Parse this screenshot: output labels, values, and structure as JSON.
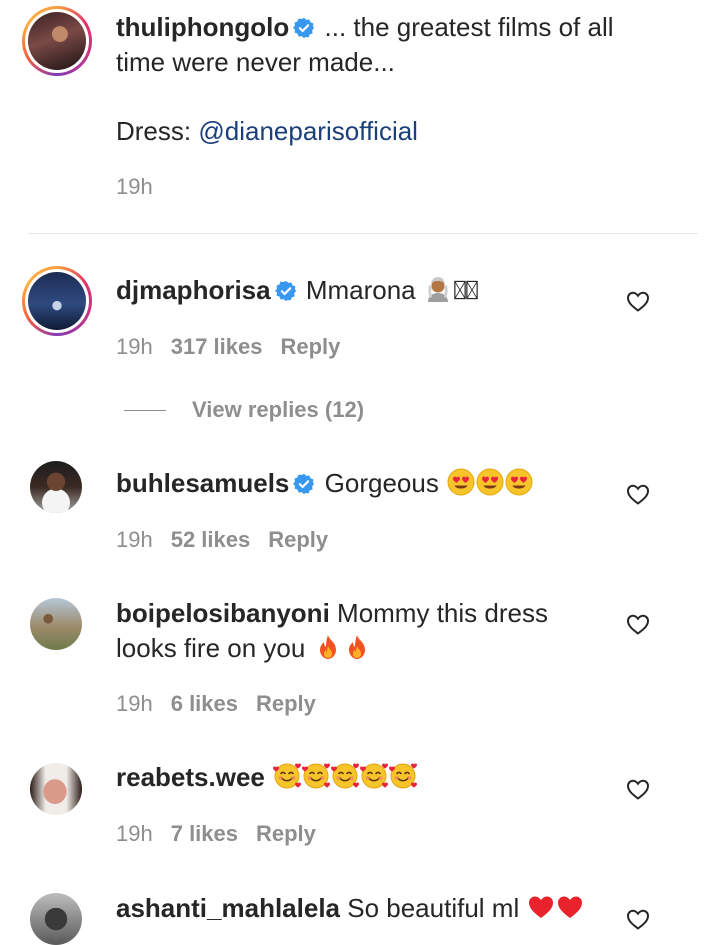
{
  "caption": {
    "username": "thuliphongolo",
    "text_line1": "... the greatest films of all",
    "text_line2": "time were never made...",
    "dress_label": "Dress:",
    "mention": "@dianeparisofficial",
    "time": "19h"
  },
  "comments": [
    {
      "username": "djmaphorisa",
      "text": "Mmarona",
      "emoji_icons": [
        "person-emoji",
        "missing-glyph",
        "missing-glyph"
      ],
      "time": "19h",
      "likes": "317 likes",
      "reply": "Reply",
      "view_replies": "View replies (12)"
    },
    {
      "username": "buhlesamuels",
      "text": "Gorgeous",
      "emoji_icons": [
        "heart-eyes-emoji",
        "heart-eyes-emoji",
        "heart-eyes-emoji"
      ],
      "time": "19h",
      "likes": "52 likes",
      "reply": "Reply"
    },
    {
      "username": "boipelosibanyoni",
      "text_line1": "Mommy this dress",
      "text_line2": "looks fire on you",
      "emoji_icons": [
        "fire-emoji",
        "fire-emoji"
      ],
      "time": "19h",
      "likes": "6 likes",
      "reply": "Reply"
    },
    {
      "username": "reabets.wee",
      "emoji_icons": [
        "smiling-hearts-emoji",
        "smiling-hearts-emoji",
        "smiling-hearts-emoji",
        "smiling-hearts-emoji",
        "smiling-hearts-emoji"
      ],
      "time": "19h",
      "likes": "7 likes",
      "reply": "Reply"
    },
    {
      "username": "ashanti_mahlalela",
      "text": "So beautiful ml",
      "emoji_icons": [
        "red-heart-emoji",
        "red-heart-emoji"
      ]
    }
  ],
  "colors": {
    "text": "#262626",
    "meta": "#8e8e8e",
    "mention": "#1b3f7a",
    "verified": "#3897f0"
  }
}
